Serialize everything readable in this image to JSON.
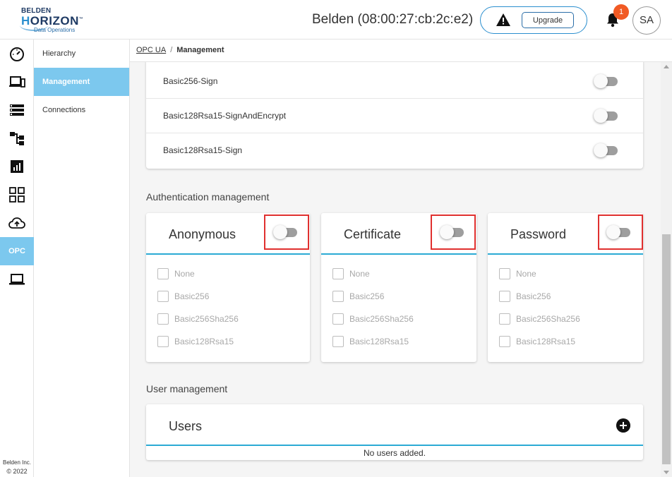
{
  "brand": {
    "line1": "BELDEN",
    "line2_a": "H",
    "line2_b": "RIZON",
    "tm": "™",
    "line3": "Data Operations"
  },
  "header": {
    "device_title": "Belden (08:00:27:cb:2c:e2)",
    "upgrade_label": "Upgrade",
    "notification_count": "1",
    "avatar_initials": "SA",
    "accent_color": "#2b8fcf",
    "badge_color": "#f15a24"
  },
  "rail": {
    "items": [
      "dashboard-icon",
      "devices-icon",
      "list-icon",
      "hierarchy-icon",
      "chart-icon",
      "apps-icon",
      "cloud-upload-icon",
      "opc-icon",
      "laptop-icon"
    ],
    "opc_label": "OPC",
    "active_color": "#7cc8ee",
    "footer_line1": "Belden Inc.",
    "footer_line2": "© 2022"
  },
  "submenu": {
    "items": [
      {
        "label": "Hierarchy",
        "active": false
      },
      {
        "label": "Management",
        "active": true
      },
      {
        "label": "Connections",
        "active": false
      }
    ]
  },
  "breadcrumb": {
    "root": "OPC UA",
    "separator": "/",
    "current": "Management"
  },
  "security_policies": [
    {
      "label": "Basic256-Sign",
      "enabled": false
    },
    {
      "label": "Basic128Rsa15-SignAndEncrypt",
      "enabled": false
    },
    {
      "label": "Basic128Rsa15-Sign",
      "enabled": false
    }
  ],
  "auth": {
    "section_title": "Authentication management",
    "cards": [
      {
        "title": "Anonymous",
        "enabled": false,
        "options": [
          "None",
          "Basic256",
          "Basic256Sha256",
          "Basic128Rsa15"
        ]
      },
      {
        "title": "Certificate",
        "enabled": false,
        "options": [
          "None",
          "Basic256",
          "Basic256Sha256",
          "Basic128Rsa15"
        ]
      },
      {
        "title": "Password",
        "enabled": false,
        "options": [
          "None",
          "Basic256",
          "Basic256Sha256",
          "Basic128Rsa15"
        ]
      }
    ],
    "highlight_color": "#e0302f"
  },
  "users": {
    "section_title": "User management",
    "card_title": "Users",
    "empty_message": "No users added."
  }
}
